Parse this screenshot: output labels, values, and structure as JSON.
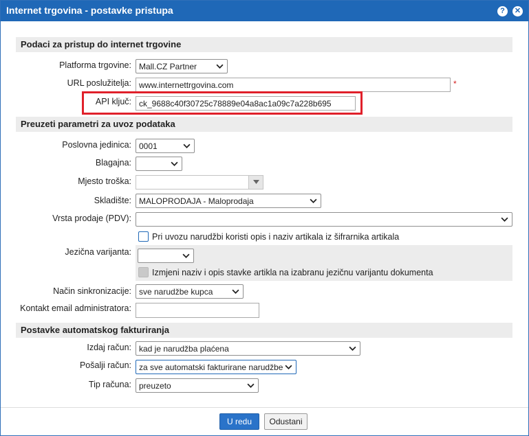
{
  "dialog": {
    "title": "Internet trgovina - postavke pristupa",
    "help_icon": "question-icon",
    "close_icon": "close-icon"
  },
  "section_access": {
    "title": "Podaci za pristup do internet trgovine",
    "platform_label": "Platforma trgovine:",
    "platform_value": "Mall.CZ Partner",
    "url_label": "URL poslužitelja:",
    "url_value": "www.internettrgovina.com",
    "required_mark": "*",
    "api_label": "API ključ:",
    "api_value": "ck_9688c40f30725c78889e04a8ac1a09c7a228b695"
  },
  "section_import": {
    "title": "Preuzeti parametri za uvoz podataka",
    "unit_label": "Poslovna jedinica:",
    "unit_value": "0001",
    "cashbox_label": "Blagajna:",
    "cashbox_value": "",
    "cost_label": "Mjesto troška:",
    "cost_value": "",
    "warehouse_label": "Skladište:",
    "warehouse_value": "MALOPRODAJA - Maloprodaja",
    "sale_type_label": "Vrsta prodaje (PDV):",
    "sale_type_value": "",
    "use_catalog_label": "Pri uvozu narudžbi koristi opis i naziv artikala iz šifrarnika artikala",
    "language_label": "Jezična varijanta:",
    "language_value": "",
    "change_name_label": "Izmjeni naziv i opis stavke artikla na izabranu jezičnu varijantu dokumenta",
    "sync_label": "Način sinkronizacije:",
    "sync_value": "sve narudžbe kupca",
    "admin_email_label": "Kontakt email administratora:",
    "admin_email_value": ""
  },
  "section_invoicing": {
    "title": "Postavke automatskog fakturiranja",
    "issue_label": "Izdaj račun:",
    "issue_value": "kad je narudžba plaćena",
    "send_label": "Pošalji račun:",
    "send_value": "za sve automatski fakturirane narudžbe",
    "type_label": "Tip računa:",
    "type_value": "preuzeto"
  },
  "footer": {
    "ok_label": "U redu",
    "cancel_label": "Odustani"
  },
  "colors": {
    "titlebar": "#1f68b7",
    "highlight": "#e0202a",
    "section_bg": "#ececec",
    "primary_button": "#2a73c9"
  }
}
